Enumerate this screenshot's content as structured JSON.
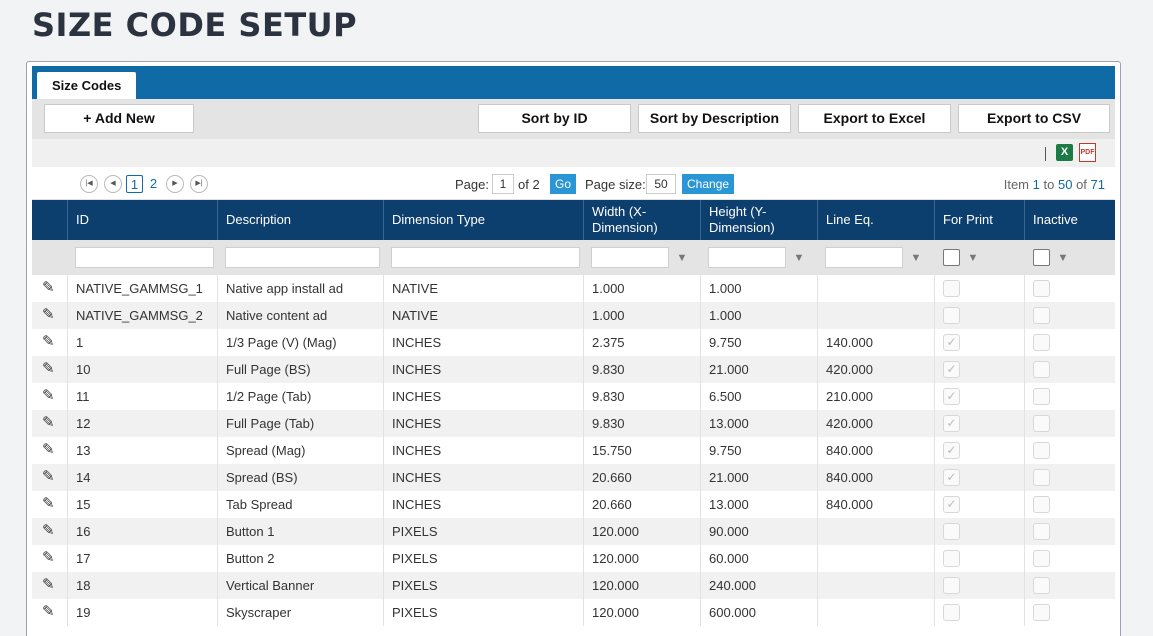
{
  "page_title": "SIZE CODE SETUP",
  "tab": "Size Codes",
  "toolbar": {
    "add_new": "+ Add New",
    "sort_id": "Sort by ID",
    "sort_desc": "Sort by Description",
    "export_excel": "Export to Excel",
    "export_csv": "Export to CSV"
  },
  "export_icons": {
    "excel": "X",
    "pdf": "PDF"
  },
  "pager": {
    "pages": [
      "1",
      "2"
    ],
    "page_label": "Page:",
    "page_value": "1",
    "of_label": "of 2",
    "go": "Go",
    "size_label": "Page size:",
    "size_value": "50",
    "change": "Change",
    "item_prefix": "Item",
    "item_from": "1",
    "item_to_label": "to",
    "item_to": "50",
    "item_of_label": "of",
    "item_total": "71"
  },
  "columns": [
    "ID",
    "Description",
    "Dimension Type",
    "Width (X-Dimension)",
    "Height (Y-Dimension)",
    "Line Eq.",
    "For Print",
    "Inactive"
  ],
  "rows": [
    {
      "id": "NATIVE_GAMMSG_1",
      "desc": "Native app install ad",
      "dim": "NATIVE",
      "w": "1.000",
      "h": "1.000",
      "line": "",
      "print": false,
      "inactive": false
    },
    {
      "id": "NATIVE_GAMMSG_2",
      "desc": "Native content ad",
      "dim": "NATIVE",
      "w": "1.000",
      "h": "1.000",
      "line": "",
      "print": false,
      "inactive": false
    },
    {
      "id": "1",
      "desc": "1/3 Page (V) (Mag)",
      "dim": "INCHES",
      "w": "2.375",
      "h": "9.750",
      "line": "140.000",
      "print": true,
      "inactive": false
    },
    {
      "id": "10",
      "desc": "Full Page (BS)",
      "dim": "INCHES",
      "w": "9.830",
      "h": "21.000",
      "line": "420.000",
      "print": true,
      "inactive": false
    },
    {
      "id": "11",
      "desc": "1/2 Page (Tab)",
      "dim": "INCHES",
      "w": "9.830",
      "h": "6.500",
      "line": "210.000",
      "print": true,
      "inactive": false
    },
    {
      "id": "12",
      "desc": "Full Page (Tab)",
      "dim": "INCHES",
      "w": "9.830",
      "h": "13.000",
      "line": "420.000",
      "print": true,
      "inactive": false
    },
    {
      "id": "13",
      "desc": "Spread (Mag)",
      "dim": "INCHES",
      "w": "15.750",
      "h": "9.750",
      "line": "840.000",
      "print": true,
      "inactive": false
    },
    {
      "id": "14",
      "desc": "Spread (BS)",
      "dim": "INCHES",
      "w": "20.660",
      "h": "21.000",
      "line": "840.000",
      "print": true,
      "inactive": false
    },
    {
      "id": "15",
      "desc": "Tab Spread",
      "dim": "INCHES",
      "w": "20.660",
      "h": "13.000",
      "line": "840.000",
      "print": true,
      "inactive": false
    },
    {
      "id": "16",
      "desc": "Button 1",
      "dim": "PIXELS",
      "w": "120.000",
      "h": "90.000",
      "line": "",
      "print": false,
      "inactive": false
    },
    {
      "id": "17",
      "desc": "Button 2",
      "dim": "PIXELS",
      "w": "120.000",
      "h": "60.000",
      "line": "",
      "print": false,
      "inactive": false
    },
    {
      "id": "18",
      "desc": "Vertical Banner",
      "dim": "PIXELS",
      "w": "120.000",
      "h": "240.000",
      "line": "",
      "print": false,
      "inactive": false
    },
    {
      "id": "19",
      "desc": "Skyscraper",
      "dim": "PIXELS",
      "w": "120.000",
      "h": "600.000",
      "line": "",
      "print": false,
      "inactive": false
    }
  ]
}
